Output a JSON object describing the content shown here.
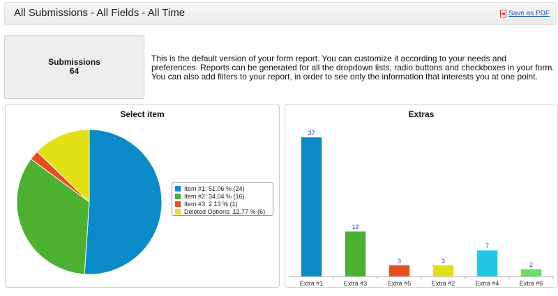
{
  "header": {
    "title": "All Submissions - All Fields - All Time",
    "pdf_label": "Save as PDF"
  },
  "summary": {
    "label": "Submissions",
    "count": "64"
  },
  "description": "This is the default version of your form report. You can customize it according to your needs and preferences. Reports can be generated for all the dropdown lists, radio buttons and checkboxes in your form. You can also add filters to your report, in order to see only the information that interests you at one point.",
  "icons": {
    "pdf": "pdf-icon"
  },
  "chart_data": [
    {
      "type": "pie",
      "title": "Select item",
      "legend_position": "right",
      "slices": [
        {
          "label": "Item #1",
          "value": 24,
          "percent": 51.06,
          "color": "#0b8ac8",
          "legend": "Item #1: 51.06 % (24)"
        },
        {
          "label": "Item #2",
          "value": 16,
          "percent": 34.04,
          "color": "#4cb030",
          "legend": "Item #2: 34.04 % (16)"
        },
        {
          "label": "Item #3",
          "value": 1,
          "percent": 2.13,
          "color": "#e84d1c",
          "legend": "Item #3: 2.13 % (1)"
        },
        {
          "label": "Deleted Options",
          "value": 6,
          "percent": 12.77,
          "color": "#e0e014",
          "legend": "Deleted Options: 12.77 % (6)"
        }
      ]
    },
    {
      "type": "bar",
      "title": "Extras",
      "categories": [
        "Extra #1",
        "Extra #3",
        "Extra #5",
        "Extra #2",
        "Extra #4",
        "Extra #6"
      ],
      "values": [
        37,
        12,
        3,
        3,
        7,
        2
      ],
      "colors": [
        "#0b8ac8",
        "#4cb030",
        "#e84d1c",
        "#e0e014",
        "#22c8e6",
        "#66e066"
      ],
      "label_color": "#2244aa",
      "ylim": [
        0,
        37
      ]
    }
  ]
}
